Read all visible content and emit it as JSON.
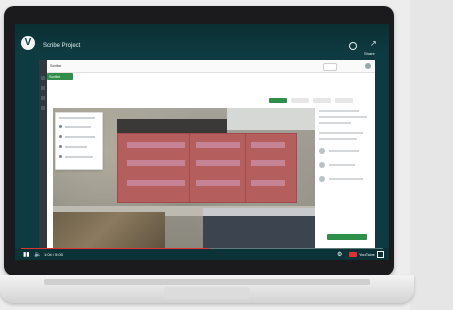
{
  "youtube": {
    "title": "Scribe Project",
    "share_label": "Share",
    "time_text": "1:04 / 5:03",
    "youtube_label": "YouTube",
    "progress": 0.52
  },
  "app": {
    "title": "Scribe",
    "tag_label": "Scribe"
  },
  "icons": {
    "channel": "channel-logo-icon",
    "clock": "clock-icon",
    "share": "share-icon",
    "play": "play-icon",
    "volume": "volume-icon",
    "settings": "settings-icon",
    "youtube": "youtube-icon",
    "fullscreen": "fullscreen-icon"
  },
  "colors": {
    "screen_bg": "#0e3b41",
    "app_green": "#2e8e4a",
    "roof_red": "#b55e5e",
    "progress_red": "#e03131"
  }
}
